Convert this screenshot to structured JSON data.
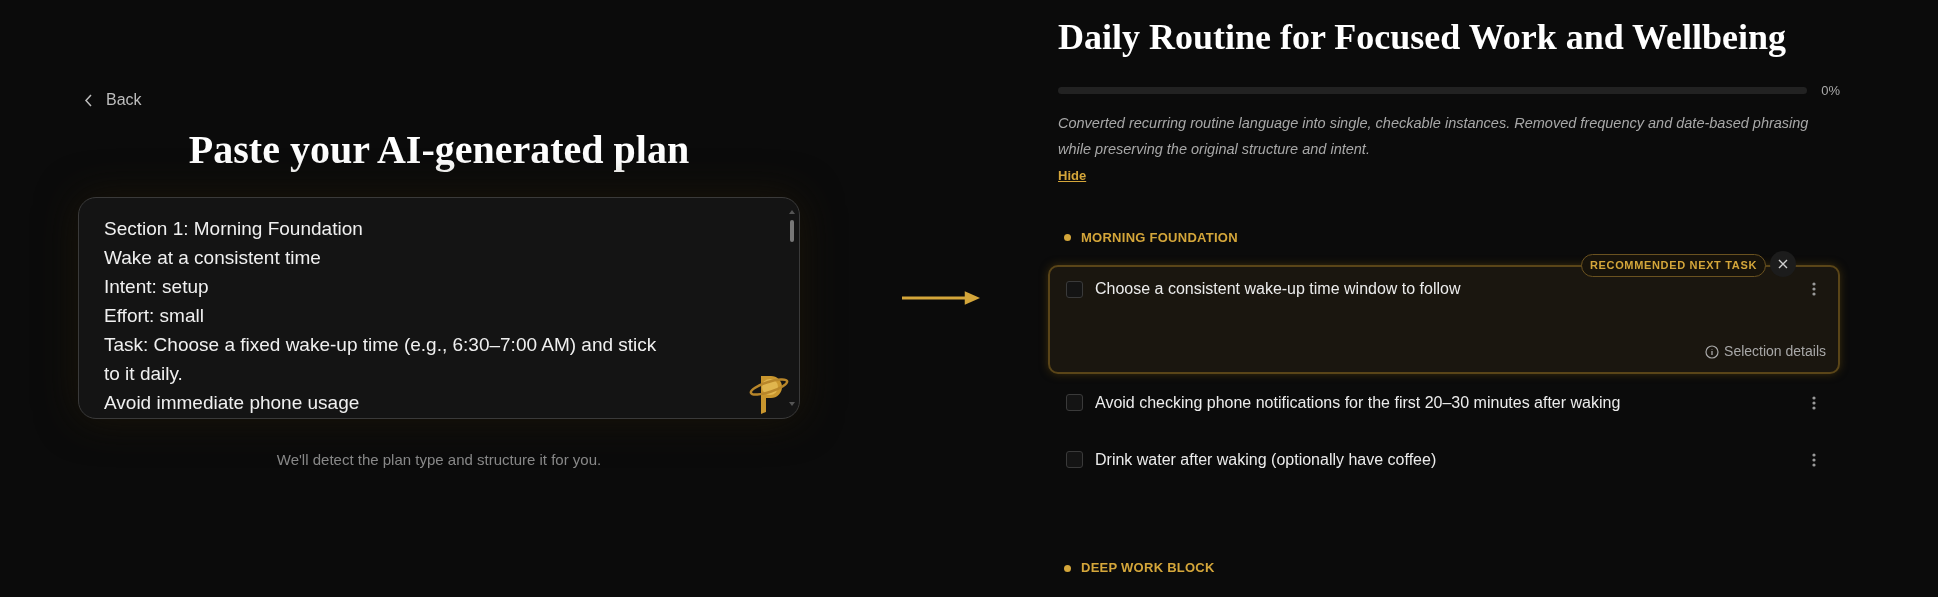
{
  "left": {
    "back": "Back",
    "title": "Paste your AI-generated plan",
    "plan_text": "Section 1: Morning Foundation\nWake at a consistent time\nIntent: setup\nEffort: small\nTask: Choose a fixed wake-up time (e.g., 6:30–7:00 AM) and stick to it daily.\nAvoid immediate phone usage",
    "caption": "We'll detect the plan type and structure it for you."
  },
  "right": {
    "title": "Daily Routine for Focused Work and Wellbeing",
    "progress": {
      "level": 0,
      "reading": "0%"
    },
    "note": "Converted recurring routine language into single, checkable instances. Removed frequency and date-based phrasing while preserving the original structure and intent.",
    "hide": "Hide",
    "sections": [
      {
        "title": "MORNING FOUNDATION",
        "tasks": [
          {
            "text": "Choose a consistent wake-up time window to follow",
            "checked": false,
            "recommended": true,
            "badge": "RECOMMENDED NEXT TASK",
            "details": "Selection details"
          },
          {
            "text": "Avoid checking phone notifications for the first 20–30 minutes after waking",
            "checked": false,
            "recommended": false
          },
          {
            "text": "Drink water after waking (optionally have coffee)",
            "checked": false,
            "recommended": false
          }
        ]
      },
      {
        "title": "DEEP WORK BLOCK"
      }
    ]
  }
}
